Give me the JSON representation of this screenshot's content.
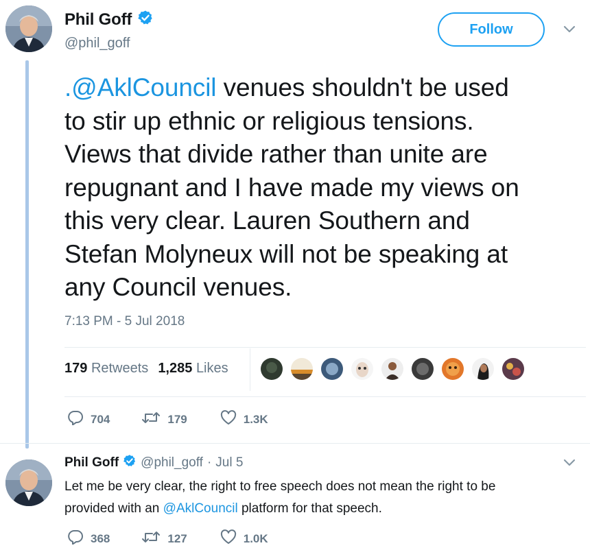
{
  "tweet": {
    "author_name": "Phil Goff",
    "handle": "@phil_goff",
    "follow_label": "Follow",
    "text_mention": ".@AklCouncil",
    "text_body_1": " venues shouldn't be used",
    "text_body_2": "to stir up ethnic or religious tensions.",
    "text_body_3": "Views that divide rather than unite are",
    "text_body_4": "repugnant and I have made my views on",
    "text_body_5": "this very clear. Lauren Southern and",
    "text_body_6": "Stefan Molyneux will not be speaking at",
    "text_body_7": "any Council venues.",
    "timestamp": "7:13 PM - 5 Jul 2018",
    "retweets_count": "179",
    "retweets_label": "Retweets",
    "likes_count": "1,285",
    "likes_label": "Likes",
    "actions": {
      "replies": "704",
      "retweets": "179",
      "likes": "1.3K"
    }
  },
  "reply": {
    "author_name": "Phil Goff",
    "handle": "@phil_goff",
    "dot": "·",
    "date": "Jul 5",
    "text_1": "Let me be very clear, the right to free speech does not mean the right to be",
    "text_2_pre": "provided with an ",
    "text_2_mention": "@AklCouncil",
    "text_2_post": " platform for that speech.",
    "actions": {
      "replies": "368",
      "retweets": "127",
      "likes": "1.0K"
    }
  },
  "colors": {
    "accent": "#1da1f2",
    "mention": "#1b95e0",
    "muted": "#657786",
    "thread": "#a9c7e8"
  },
  "icons": [
    "verified-badge-icon",
    "chevron-down-icon",
    "reply-icon",
    "retweet-icon",
    "like-icon"
  ]
}
